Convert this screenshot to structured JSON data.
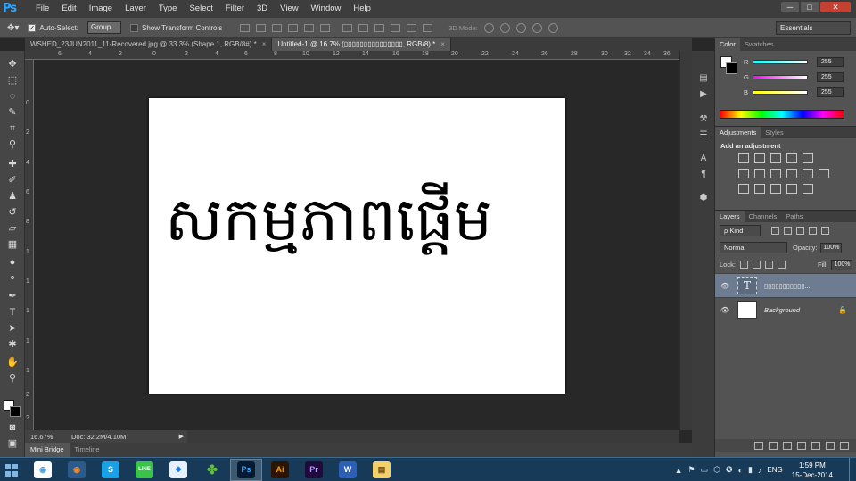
{
  "app": {
    "logo": "Ps"
  },
  "menu": [
    "File",
    "Edit",
    "Image",
    "Layer",
    "Type",
    "Select",
    "Filter",
    "3D",
    "View",
    "Window",
    "Help"
  ],
  "window_controls": {
    "minimize": "─",
    "maximize": "□",
    "close": "✕"
  },
  "options_bar": {
    "auto_select_label": "Auto-Select:",
    "auto_select_value": "Group",
    "transform_label": "Show Transform Controls",
    "mode3d_label": "3D Mode:",
    "workspace": "Essentials"
  },
  "tabs": [
    {
      "title": "WSHED_23JUN2011_11-Recovered.jpg @ 33.3% (Shape 1, RGB/8#) *",
      "close": "×"
    },
    {
      "title": "Untitled-1 @ 16.7% (▯▯▯▯▯▯▯▯▯▯▯▯▯▯▯, RGB/8) *",
      "close": "×"
    }
  ],
  "ruler": {
    "top": [
      "6",
      "4",
      "2",
      "0",
      "2",
      "4",
      "6",
      "8",
      "10",
      "12",
      "14",
      "16",
      "18",
      "20",
      "22",
      "24",
      "26",
      "28",
      "30",
      "32",
      "34",
      "36"
    ],
    "left": [
      "0",
      "2",
      "4",
      "6",
      "8",
      "1",
      "1",
      "1",
      "1",
      "1",
      "2",
      "2"
    ]
  },
  "canvas": {
    "text": "សកម្មភាពផ្ដើម"
  },
  "status": {
    "zoom": "16.67%",
    "doc": "Doc: 32.2M/4.10M",
    "arrow": "▶"
  },
  "bottom_tabs": [
    "Mini Bridge",
    "Timeline"
  ],
  "color_panel": {
    "tabs": [
      "Color",
      "Swatches"
    ],
    "channels": [
      {
        "label": "R",
        "value": "255"
      },
      {
        "label": "G",
        "value": "255"
      },
      {
        "label": "B",
        "value": "255"
      }
    ]
  },
  "adjustments_panel": {
    "tabs": [
      "Adjustments",
      "Styles"
    ],
    "title": "Add an adjustment"
  },
  "layers_panel": {
    "tabs": [
      "Layers",
      "Channels",
      "Paths"
    ],
    "kind": "ρ Kind",
    "blend_mode": "Normal",
    "opacity_label": "Opacity:",
    "opacity": "100%",
    "lock_label": "Lock:",
    "fill_label": "Fill:",
    "fill": "100%",
    "layers": [
      {
        "name": "▯▯▯▯▯▯▯▯▯▯▯...",
        "thumb": "T",
        "eye": "👁"
      },
      {
        "name": "Background",
        "eye": "👁",
        "lock": "🔒"
      }
    ]
  },
  "taskbar": {
    "apps": [
      {
        "name": "chrome",
        "glyph": "◉",
        "color": "#4aa3df",
        "bg": "#ffffff"
      },
      {
        "name": "firefox",
        "glyph": "◉",
        "color": "#ff8a1f",
        "bg": "#2a5b8a"
      },
      {
        "name": "skype",
        "glyph": "S",
        "color": "#ffffff",
        "bg": "#1aa0e6"
      },
      {
        "name": "line",
        "glyph": "LINE",
        "color": "#ffffff",
        "bg": "#3ac34a"
      },
      {
        "name": "dropbox",
        "glyph": "❖",
        "color": "#1f7ae0",
        "bg": "#e8f2fc"
      },
      {
        "name": "clover",
        "glyph": "✤",
        "color": "#63c03a",
        "bg": "transparent"
      },
      {
        "name": "photoshop",
        "glyph": "Ps",
        "color": "#31a8ff",
        "bg": "#061b33"
      },
      {
        "name": "illustrator",
        "glyph": "Ai",
        "color": "#ff9a00",
        "bg": "#2b1400"
      },
      {
        "name": "premiere",
        "glyph": "Pr",
        "color": "#b99cff",
        "bg": "#1f0a3a"
      },
      {
        "name": "word",
        "glyph": "W",
        "color": "#ffffff",
        "bg": "#2b5fb8"
      },
      {
        "name": "explorer",
        "glyph": "▤",
        "color": "#6b4a10",
        "bg": "#f2cf6a"
      }
    ],
    "tray_icons": [
      "▲",
      "⚑",
      "▭",
      "⬡",
      "✪",
      "◐",
      "▮",
      "♪"
    ],
    "language": "ENG",
    "time": "1:59 PM",
    "date": "15-Dec-2014"
  }
}
